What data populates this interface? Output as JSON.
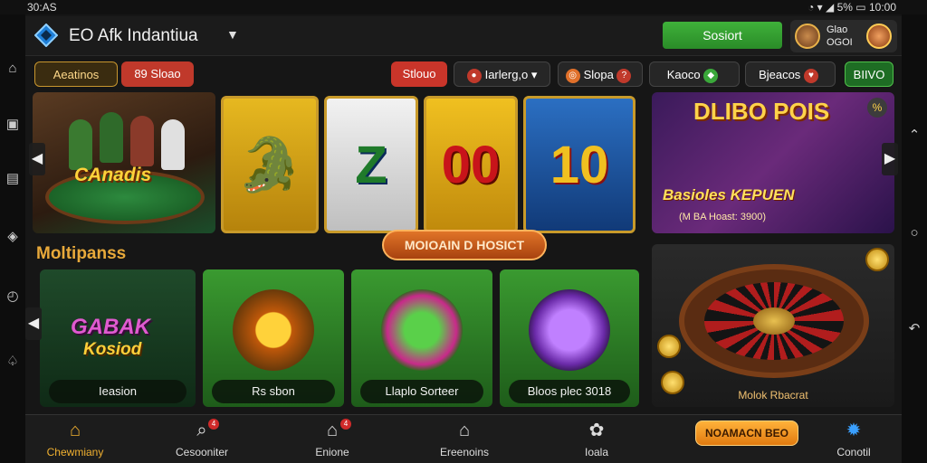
{
  "status_bar": {
    "time_left": "30:AS",
    "time_right": "10:00",
    "battery": "5%"
  },
  "header": {
    "title": "Afk Indantiua",
    "prefix": "EO",
    "signin_label": "Sosiort",
    "profile_line1": "Glao",
    "profile_line2": "OGOI"
  },
  "filters": {
    "active": "Aeatinos",
    "chip2": "89 Sloao",
    "chip3": "Stlouo",
    "chip4": "Iarlerg,o",
    "chip5": "Slopa",
    "chip6": "Kaoco",
    "chip7": "Bjeacos",
    "chip8": "BIIVO"
  },
  "banners": {
    "left_title": "CAnadis",
    "slot1_glyph": "🐊",
    "slot2_glyph": "Z",
    "slot3_glyph": "00",
    "slot4_glyph": "10",
    "mid_button": "MOIOAIN D HOSICT",
    "promo_title": "DLIBO POIS",
    "promo_sub": "Basioles KEPUEN",
    "promo_sub2": "(M BA Hoast: 3900)",
    "promo_badge": "%"
  },
  "section": {
    "title": "Moltipanss"
  },
  "games": [
    {
      "title1": "GABAK",
      "title2": "Kosiod",
      "label": "Ieasion"
    },
    {
      "label": "Rs sbon"
    },
    {
      "label": "Llaplo Sorteer"
    },
    {
      "label": "Bloos plec 3018"
    }
  ],
  "roulette": {
    "label": "Molok Rbacrat"
  },
  "bottom_nav": {
    "items": [
      {
        "label": "Chewmiany",
        "icon": "home-icon"
      },
      {
        "label": "Cesooniter",
        "icon": "search-icon",
        "badge": "4"
      },
      {
        "label": "Enione",
        "icon": "house-icon",
        "badge": "4"
      },
      {
        "label": "Ereenoins",
        "icon": "house-icon"
      },
      {
        "label": "Ioala",
        "icon": "settings-icon"
      },
      {
        "label": "Conotil",
        "icon": "gear-icon"
      }
    ],
    "bonus_label": "NOAMACN BEO"
  },
  "colors": {
    "accent": "#f0b030",
    "signin": "#2f9c2c",
    "chip_red": "#c0392b"
  }
}
